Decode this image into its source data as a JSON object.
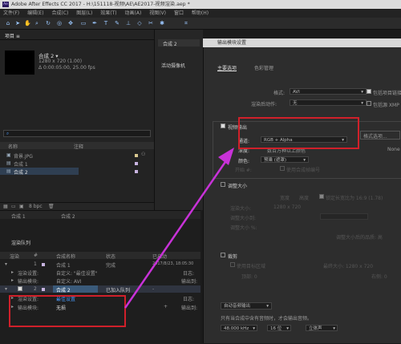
{
  "window": {
    "title": "Adobe After Effects CC 2017 - H:\\151118-视频\\AE\\AE2017-视频渲染.aep *",
    "logo": "Ae"
  },
  "menu": [
    "文件(F)",
    "编辑(E)",
    "合成(C)",
    "图层(L)",
    "效果(T)",
    "动画(A)",
    "视图(V)",
    "窗口",
    "帮助(H)"
  ],
  "project": {
    "tab": "项目 ≡",
    "selected_name": "合成 2 ▾",
    "size": "1280 x 720 (1.00)",
    "duration": "Δ 0:00:05:00, 25.00 fps",
    "search_placeholder": "",
    "col_name": "名称",
    "col_comment": "注释",
    "items": [
      "背景.JPG",
      "合成 1",
      "合成 2"
    ],
    "bpc": "8 bpc"
  },
  "comp_panel": {
    "tab": "合成 2",
    "sub": "活动摄像机"
  },
  "timeline": {
    "tabs": [
      "合成 1",
      "合成 2"
    ],
    "queue_title": "渲染队列",
    "headers": [
      "渲染",
      "#",
      "合成名称",
      "状态",
      "已启动"
    ],
    "rows": [
      {
        "num": "1",
        "name": "合成 1",
        "status": "完成",
        "time": "2017/8/23, 18:05:30"
      },
      {
        "label": "渲染设置:",
        "value": "自定义: \"最佳设置\"",
        "right": "日志:"
      },
      {
        "label": "输出模块:",
        "value": "自定义: AVI",
        "right": "输出到:"
      },
      {
        "num": "2",
        "name": "合成 2",
        "status": "已加入队列",
        "time": "-"
      },
      {
        "label": "渲染设置:",
        "value": "最佳设置",
        "right": "日志:"
      },
      {
        "label": "输出模块:",
        "value": "无损",
        "right": "输出到:"
      }
    ],
    "plus": "+"
  },
  "dialog": {
    "title": "输出模块设置",
    "tabs": [
      "主要选项",
      "色彩管理"
    ],
    "format_label": "格式:",
    "format_value": "AVI",
    "after_render_label": "渲染后动作:",
    "after_render_value": "无",
    "include_project": "包括项目链接",
    "include_source": "包括源 XMP",
    "video_output": "视频输出",
    "channel_label": "通道:",
    "channel_value": "RGB + Alpha",
    "color_label": "深度:",
    "color_value": "数百万种以上颜色",
    "color_mode_label": "颜色:",
    "color_mode_value": "预乘 (遮罩)",
    "start_label": "开始 #:",
    "use_comp_frame": "使用合成帧编号",
    "format_options": "格式选项...",
    "none_label": "None",
    "resize": "调整大小",
    "resize_width": "宽度",
    "resize_height": "高度",
    "resize_lock": "锁定长宽比为 16:9 (1.78)",
    "render_size_label": "渲染大小:",
    "render_size": "1280 x 720",
    "resize_to_label": "调整大小到:",
    "resize_pct_label": "调整大小 %:",
    "resize_quality": "调整大小后的品质: 高",
    "crop": "裁剪",
    "crop_roi": "使用目标区域",
    "crop_final": "最终大小: 1280 x 720",
    "crop_top": "顶部: 0",
    "crop_right": "右侧: 0",
    "audio_label": "自动音频输出",
    "audio_note": "只有当合成中含有音频时，才会输出音频。",
    "audio_rate": "48.000 kHz",
    "audio_bits": "16 位",
    "audio_channels": "立体声"
  },
  "colors": {
    "highlight": "#d0202a",
    "arrow": "#c832d8",
    "accent": "#4a9dff"
  }
}
